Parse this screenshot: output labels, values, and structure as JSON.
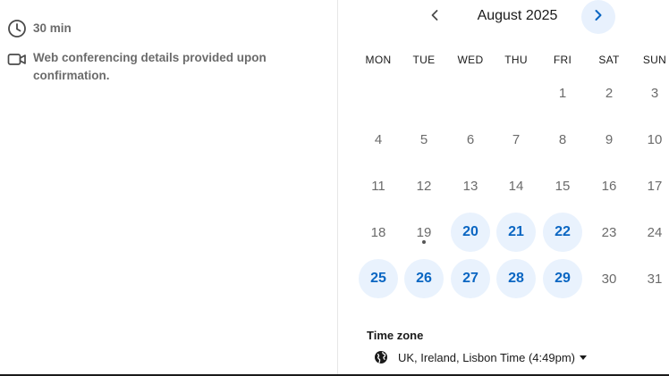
{
  "event_details": {
    "duration": "30 min",
    "conferencing": "Web conferencing details provided upon confirmation."
  },
  "calendar": {
    "month_title": "August 2025",
    "weekdays": [
      "MON",
      "TUE",
      "WED",
      "THU",
      "FRI",
      "SAT",
      "SUN"
    ],
    "days": [
      {
        "label": "1",
        "available": false
      },
      {
        "label": "2",
        "available": false
      },
      {
        "label": "3",
        "available": false
      },
      {
        "label": "4",
        "available": false
      },
      {
        "label": "5",
        "available": false
      },
      {
        "label": "6",
        "available": false
      },
      {
        "label": "7",
        "available": false
      },
      {
        "label": "8",
        "available": false
      },
      {
        "label": "9",
        "available": false
      },
      {
        "label": "10",
        "available": false
      },
      {
        "label": "11",
        "available": false
      },
      {
        "label": "12",
        "available": false
      },
      {
        "label": "13",
        "available": false
      },
      {
        "label": "14",
        "available": false
      },
      {
        "label": "15",
        "available": false
      },
      {
        "label": "16",
        "available": false
      },
      {
        "label": "17",
        "available": false
      },
      {
        "label": "18",
        "available": false
      },
      {
        "label": "19",
        "available": false,
        "today": true
      },
      {
        "label": "20",
        "available": true
      },
      {
        "label": "21",
        "available": true
      },
      {
        "label": "22",
        "available": true
      },
      {
        "label": "23",
        "available": false
      },
      {
        "label": "24",
        "available": false
      },
      {
        "label": "25",
        "available": true
      },
      {
        "label": "26",
        "available": true
      },
      {
        "label": "27",
        "available": true
      },
      {
        "label": "28",
        "available": true
      },
      {
        "label": "29",
        "available": true
      },
      {
        "label": "30",
        "available": false
      },
      {
        "label": "31",
        "available": false
      }
    ],
    "first_weekday_index": 4,
    "prev_icon": "chevron-left-icon",
    "next_icon": "chevron-right-icon"
  },
  "timezone": {
    "label": "Time zone",
    "value": "UK, Ireland, Lisbon Time (4:49pm)",
    "icon": "globe-icon"
  },
  "colors": {
    "accent": "#0a66c2",
    "available_bg": "#e9f2fd",
    "muted_text": "#6b6b6b"
  }
}
